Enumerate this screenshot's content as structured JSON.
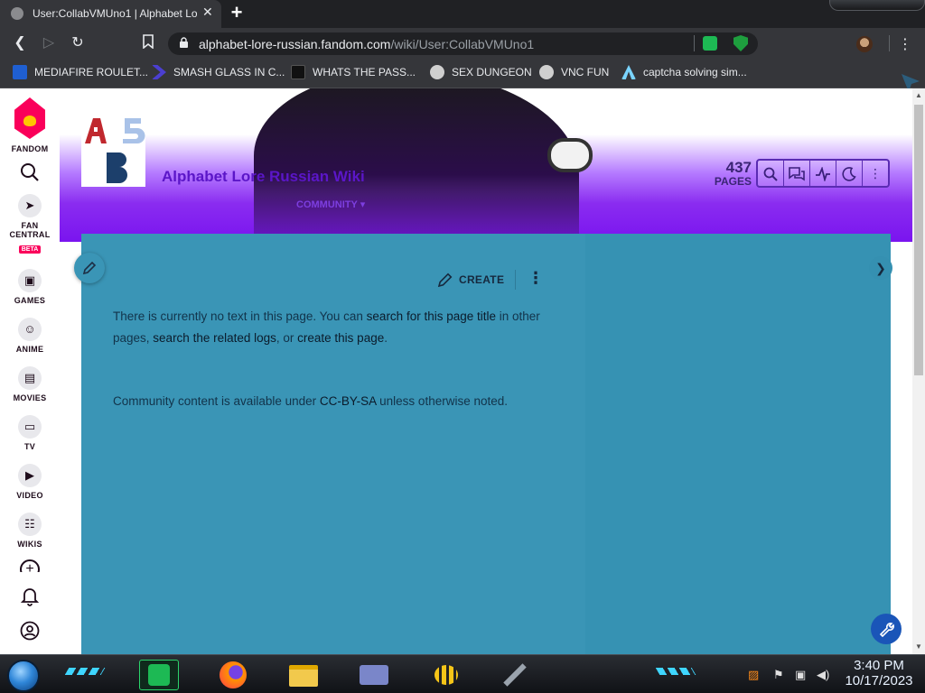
{
  "browser": {
    "tab_title": "User:CollabVMUno1 | Alphabet Lo",
    "tab_close": "✕",
    "new_tab": "+",
    "url_domain": "alphabet-lore-russian.fandom.com",
    "url_path": "/wiki/User:CollabVMUno1"
  },
  "bookmarks": [
    {
      "label": "MEDIAFIRE ROULET...",
      "icon": "mediafire-icon",
      "color": "#1f5fd1"
    },
    {
      "label": "SMASH GLASS IN C...",
      "icon": "smash-icon",
      "color": "#4b3fd1"
    },
    {
      "label": "WHATS THE PASS...",
      "icon": "black-square-icon",
      "color": "#111111"
    },
    {
      "label": "SEX DUNGEON",
      "icon": "gear-shield-icon",
      "color": "#cfcfcf"
    },
    {
      "label": "VNC FUN",
      "icon": "gear-shield-icon",
      "color": "#cfcfcf"
    },
    {
      "label": "captcha solving sim...",
      "icon": "caret-a-icon",
      "color": "#7ad4ff"
    }
  ],
  "rail": {
    "brand": "FANDOM",
    "items": [
      {
        "label": "FAN CENTRAL",
        "badge": "BETA",
        "icon": "rocket-icon"
      },
      {
        "label": "GAMES",
        "icon": "controller-icon"
      },
      {
        "label": "ANIME",
        "icon": "anime-face-icon"
      },
      {
        "label": "MOVIES",
        "icon": "clapperboard-icon"
      },
      {
        "label": "TV",
        "icon": "tv-icon"
      },
      {
        "label": "VIDEO",
        "icon": "play-icon"
      },
      {
        "label": "WIKIS",
        "icon": "book-icon"
      }
    ]
  },
  "wiki": {
    "title": "Alphabet Lore Russian Wiki",
    "nav_community": "COMMUNITY",
    "pages_count": "437",
    "pages_label": "PAGES"
  },
  "article": {
    "create_label": "CREATE",
    "msg_part1": "There is currently no text in this page. You can ",
    "msg_link1": "search for this page title",
    "msg_part2": " in other pages, ",
    "msg_link2": "search the related logs",
    "msg_part3": ", or ",
    "msg_link3": "create this page",
    "msg_part4": ".",
    "license_part1": "Community content is available under ",
    "license_link": "CC-BY-SA",
    "license_part2": " unless otherwise noted."
  },
  "taskbar": {
    "time": "3:40 PM",
    "date": "10/17/2023"
  }
}
